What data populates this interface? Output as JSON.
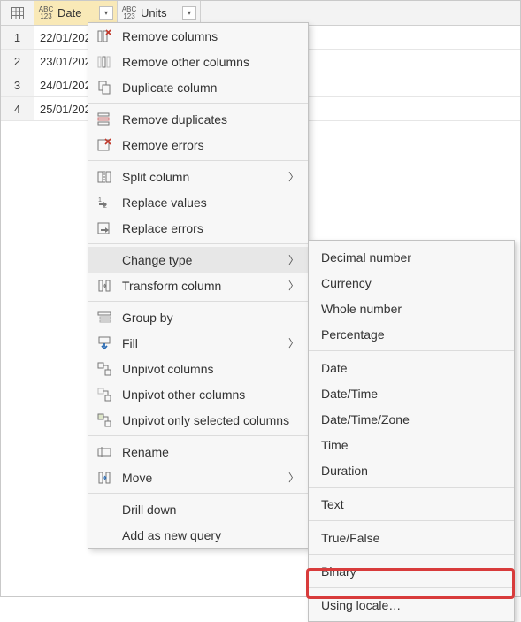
{
  "columns": {
    "date": {
      "label": "Date",
      "type_label": "ABC 123"
    },
    "units": {
      "label": "Units",
      "type_label": "ABC 123"
    }
  },
  "rows": [
    {
      "n": "1",
      "date": "22/01/202"
    },
    {
      "n": "2",
      "date": "23/01/202"
    },
    {
      "n": "3",
      "date": "24/01/202"
    },
    {
      "n": "4",
      "date": "25/01/202"
    }
  ],
  "menu": {
    "remove_columns": "Remove columns",
    "remove_other_columns": "Remove other columns",
    "duplicate_column": "Duplicate column",
    "remove_duplicates": "Remove duplicates",
    "remove_errors": "Remove errors",
    "split_column": "Split column",
    "replace_values": "Replace values",
    "replace_errors": "Replace errors",
    "change_type": "Change type",
    "transform_column": "Transform column",
    "group_by": "Group by",
    "fill": "Fill",
    "unpivot_columns": "Unpivot columns",
    "unpivot_other_columns": "Unpivot other columns",
    "unpivot_selected": "Unpivot only selected columns",
    "rename": "Rename",
    "move": "Move",
    "drill_down": "Drill down",
    "add_as_new_query": "Add as new query"
  },
  "submenu": {
    "decimal_number": "Decimal number",
    "currency": "Currency",
    "whole_number": "Whole number",
    "percentage": "Percentage",
    "date": "Date",
    "date_time": "Date/Time",
    "date_time_zone": "Date/Time/Zone",
    "time": "Time",
    "duration": "Duration",
    "text": "Text",
    "true_false": "True/False",
    "binary": "Binary",
    "using_locale": "Using locale…"
  }
}
